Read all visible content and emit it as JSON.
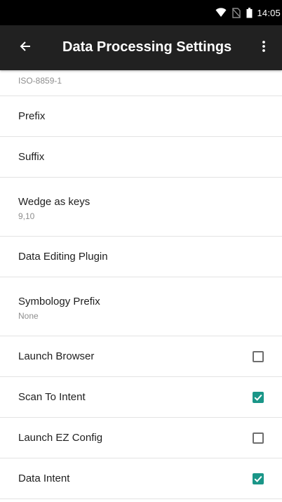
{
  "status_bar": {
    "time": "14:05",
    "icons": [
      "wifi-icon",
      "no-sim-icon",
      "battery-icon"
    ]
  },
  "app_bar": {
    "title": "Data Processing Settings",
    "back_icon": "arrow-back-icon",
    "overflow_icon": "more-vert-icon"
  },
  "partial_item": {
    "summary": "ISO-8859-1"
  },
  "items": [
    {
      "title": "Prefix"
    },
    {
      "title": "Suffix"
    },
    {
      "title": "Wedge as keys",
      "summary": "9,10"
    },
    {
      "title": "Data Editing Plugin"
    },
    {
      "title": "Symbology Prefix",
      "summary": "None"
    },
    {
      "title": "Launch Browser",
      "checked": false
    },
    {
      "title": "Scan To Intent",
      "checked": true
    },
    {
      "title": "Launch EZ Config",
      "checked": false
    },
    {
      "title": "Data Intent",
      "checked": true
    }
  ],
  "colors": {
    "status_bar": "#000000",
    "app_bar": "#212121",
    "accent": "#1a9688",
    "divider": "#e3e3e3",
    "summary_text": "#8e8e8e"
  }
}
